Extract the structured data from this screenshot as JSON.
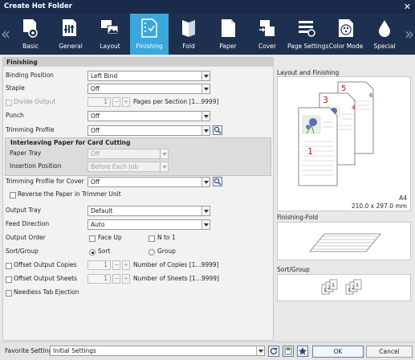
{
  "window": {
    "title": "Create Hot Folder"
  },
  "toolbar": {
    "items": [
      {
        "label": "Basic"
      },
      {
        "label": "General"
      },
      {
        "label": "Layout"
      },
      {
        "label": "Finishing"
      },
      {
        "label": "Fold"
      },
      {
        "label": "Paper"
      },
      {
        "label": "Cover"
      },
      {
        "label": "Page Settings"
      },
      {
        "label": "Color Mode"
      },
      {
        "label": "Special"
      }
    ],
    "selected": "Finishing",
    "accent_color": "#3aa8dc"
  },
  "finishing": {
    "header": "Finishing",
    "binding_position": {
      "label": "Binding Position",
      "value": "Left Bind"
    },
    "staple": {
      "label": "Staple",
      "value": "Off"
    },
    "divide_output": {
      "label": "Divide Output",
      "value": "1",
      "suffix": "Pages per Section [1...9999]"
    },
    "punch": {
      "label": "Punch",
      "value": "Off"
    },
    "trimming_profile": {
      "label": "Trimming Profile",
      "value": "Off"
    },
    "interleaving": {
      "header": "Interleaving Paper for Card Cutting",
      "paper_tray": {
        "label": "Paper Tray",
        "value": "Off"
      },
      "insertion_position": {
        "label": "Insertion Position",
        "value": "Before Each Job"
      }
    },
    "trimming_profile_cover": {
      "label": "Trimming Profile for Cover",
      "value": "Off"
    },
    "reverse_paper": {
      "label": "Reverse the Paper in Trimmer Unit"
    },
    "output_tray": {
      "label": "Output Tray",
      "value": "Default"
    },
    "feed_direction": {
      "label": "Feed Direction",
      "value": "Auto"
    },
    "output_order": {
      "label": "Output Order",
      "face_up": "Face Up",
      "n_to_1": "N to 1"
    },
    "sort_group": {
      "label": "Sort/Group",
      "sort": "Sort",
      "group": "Group",
      "selected": "Sort"
    },
    "offset_copies": {
      "label": "Offset Output Copies",
      "value": "1",
      "suffix": "Number of Copies [1...9999]"
    },
    "offset_sheets": {
      "label": "Offset Output Sheets",
      "value": "1",
      "suffix": "Number of Sheets [1...9999]"
    },
    "needless_tab": {
      "label": "Needless Tab Ejection"
    }
  },
  "right_panel": {
    "layout_title": "Layout and Finishing",
    "paper_size": "A4",
    "paper_dims": "210.0 x 297.0 mm",
    "page_numbers": [
      "1",
      "3",
      "4",
      "5",
      "6"
    ],
    "fold_title": "Finishing-Fold",
    "sort_title": "Sort/Group",
    "sort_digits": [
      "1",
      "2",
      "3",
      "1",
      "2",
      "3"
    ]
  },
  "bottom": {
    "favorite_label": "Favorite Setting",
    "favorite_value": "Initial Settings",
    "ok": "OK",
    "cancel": "Cancel"
  }
}
